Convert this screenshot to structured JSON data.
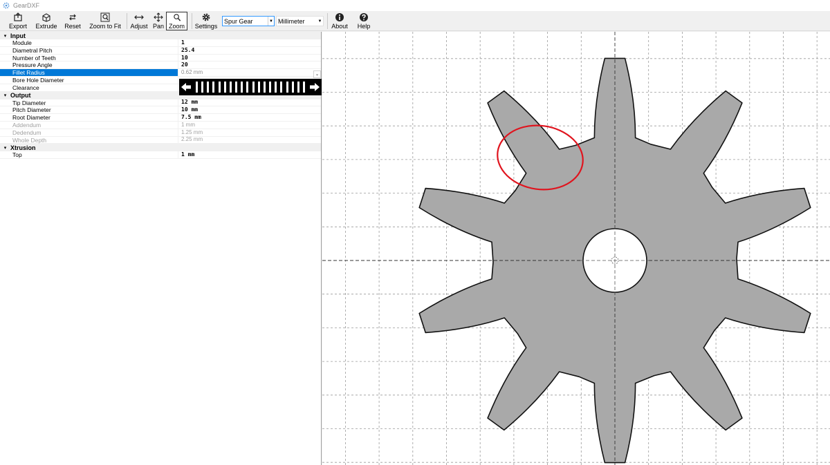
{
  "app": {
    "title": "GearDXF",
    "icon": "gear-icon"
  },
  "toolbar": {
    "export": "Export",
    "extrude": "Extrude",
    "reset": "Reset",
    "zoom_to_fit": "Zoom to Fit",
    "adjust": "Adjust",
    "pan": "Pan",
    "zoom": "Zoom",
    "settings": "Settings",
    "about": "About",
    "help": "Help",
    "gear_type": "Spur Gear",
    "units": "Millimeter"
  },
  "properties": {
    "input": {
      "label": "Input",
      "rows": [
        {
          "name": "Module",
          "value": "1"
        },
        {
          "name": "Diametral Pitch",
          "value": "25.4"
        },
        {
          "name": "Number of Teeth",
          "value": "10"
        },
        {
          "name": "Pressure Angle",
          "value": "20"
        },
        {
          "name": "Fillet Radius",
          "value": "0.62 mm"
        },
        {
          "name": "Bore Hole Diameter",
          "value": ""
        },
        {
          "name": "Clearance",
          "value": ""
        }
      ]
    },
    "output": {
      "label": "Output",
      "rows": [
        {
          "name": "Tip Diameter",
          "value": "12 mm"
        },
        {
          "name": "Pitch Diameter",
          "value": "10 mm"
        },
        {
          "name": "Root Diameter",
          "value": "7.5 mm"
        },
        {
          "name": "Addendum",
          "value": "1 mm"
        },
        {
          "name": "Dedendum",
          "value": "1.25 mm"
        },
        {
          "name": "Whole Depth",
          "value": "2.25 mm"
        }
      ]
    },
    "xtrusion": {
      "label": "Xtrusion",
      "rows": [
        {
          "name": "Top",
          "value": "1 mm"
        }
      ]
    }
  },
  "colors": {
    "gear_fill": "#a9a9a9",
    "highlight_circle": "#e0141e",
    "selection": "#0078d7",
    "grid": "#9a9a9a"
  }
}
